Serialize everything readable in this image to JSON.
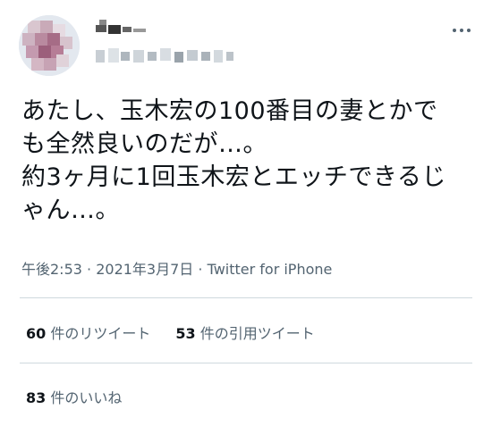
{
  "tweet": {
    "text_lines": [
      "あたし、玉木宏の100番目の妻とかで",
      "も全然良いのだが…。",
      "約3ヶ月に1回玉木宏とエッチできるじ",
      "ゃん…。"
    ],
    "time": "午後2:53",
    "separator": " · ",
    "date": "2021年3月7日",
    "source": "Twitter for iPhone"
  },
  "stats": {
    "retweets": {
      "count": "60",
      "label": "件のリツイート"
    },
    "quotes": {
      "count": "53",
      "label": "件の引用ツイート"
    },
    "likes": {
      "count": "83",
      "label": "件のいいね"
    }
  },
  "icons": {
    "more": "more-horizontal-icon"
  }
}
